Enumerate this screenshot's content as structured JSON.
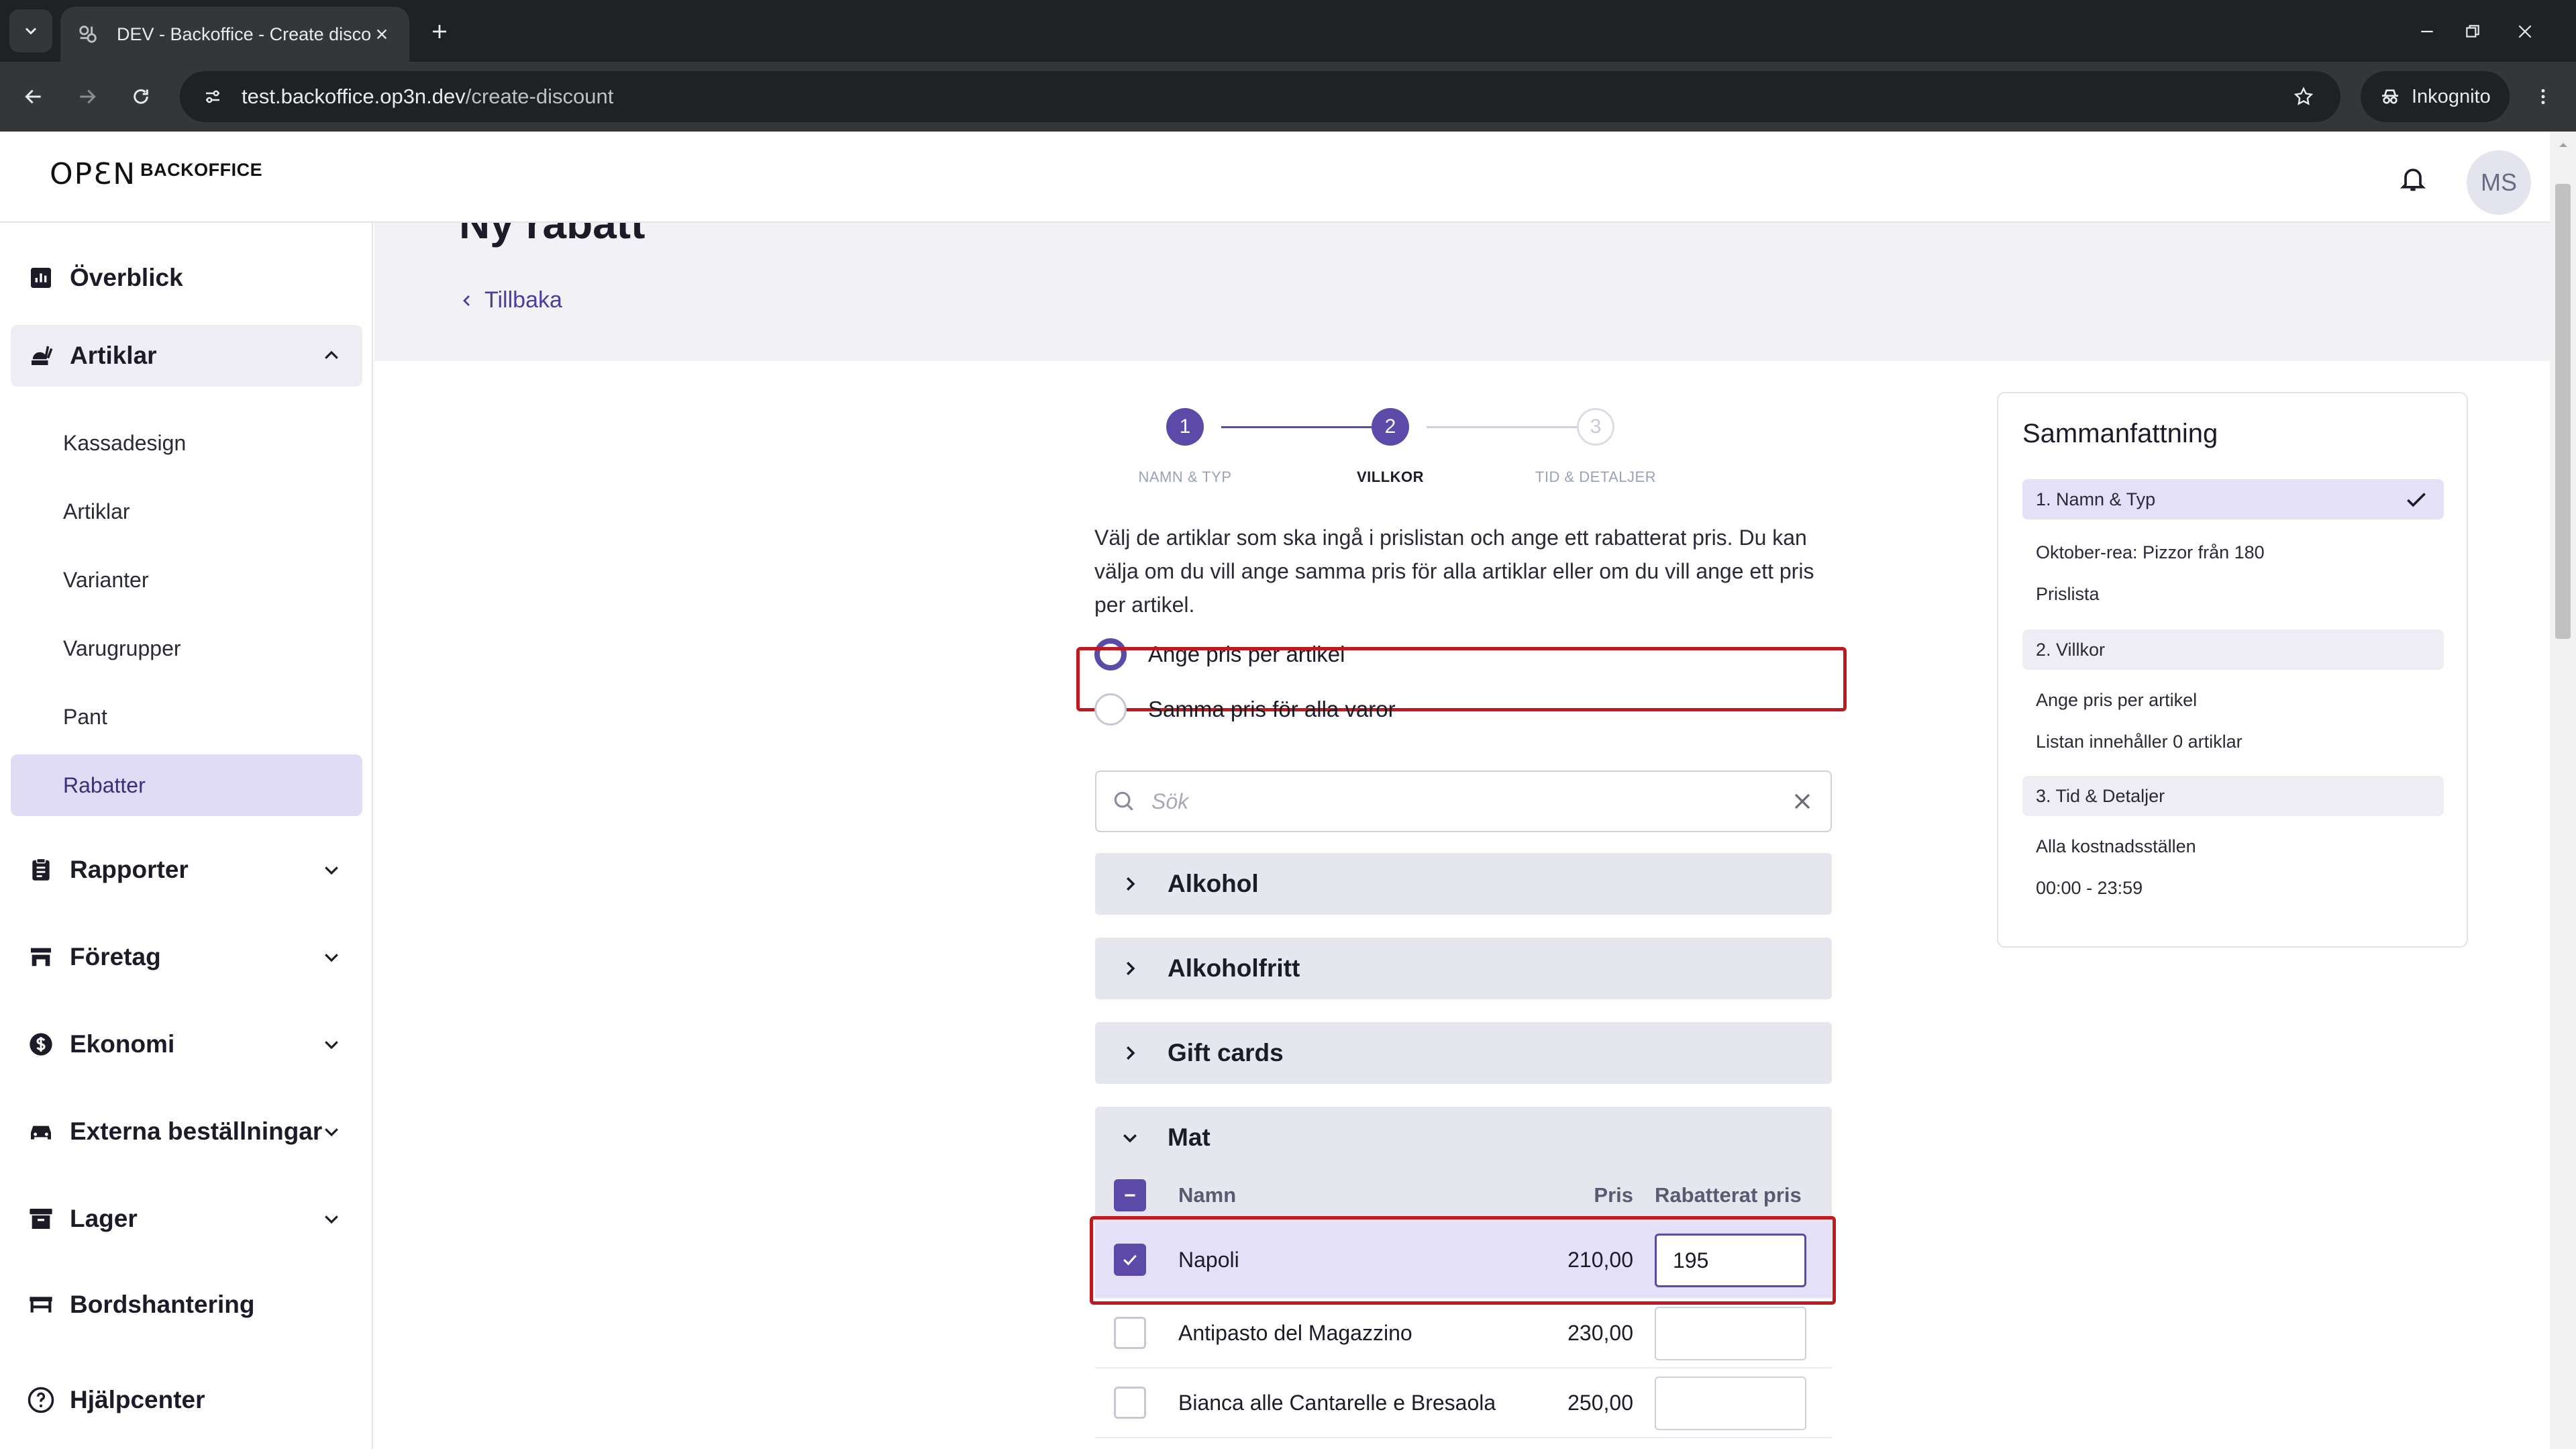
{
  "browser": {
    "tab_title": "DEV - Backoffice - Create disco",
    "url_host": "test.backoffice.op3n.dev",
    "url_path": "/create-discount",
    "incognito_label": "Inkognito"
  },
  "header": {
    "logo_mark": "OPƐN",
    "logo_text": "BACKOFFICE",
    "avatar_initials": "MS"
  },
  "sidebar": {
    "items": [
      {
        "label": "Överblick",
        "icon": "bar-chart-icon"
      },
      {
        "label": "Artiklar",
        "icon": "food-icon",
        "open": true
      },
      {
        "label": "Rapporter",
        "icon": "report-icon"
      },
      {
        "label": "Företag",
        "icon": "store-icon"
      },
      {
        "label": "Ekonomi",
        "icon": "dollar-icon"
      },
      {
        "label": "Externa beställningar",
        "icon": "car-icon"
      },
      {
        "label": "Lager",
        "icon": "archive-icon"
      },
      {
        "label": "Bordshantering",
        "icon": "table-icon"
      },
      {
        "label": "Hjälpcenter",
        "icon": "help-icon"
      }
    ],
    "sub_items": [
      "Kassadesign",
      "Artiklar",
      "Varianter",
      "Varugrupper",
      "Pant",
      "Rabatter"
    ],
    "active_sub": "Rabatter"
  },
  "page": {
    "title": "Ny rabatt",
    "back_label": "Tillbaka"
  },
  "stepper": {
    "steps": [
      {
        "number": "1",
        "label": "NAMN & TYP",
        "state": "done"
      },
      {
        "number": "2",
        "label": "VILLKOR",
        "state": "current"
      },
      {
        "number": "3",
        "label": "TID & DETALJER",
        "state": "todo"
      }
    ]
  },
  "form": {
    "intro": "Välj de artiklar som ska ingå i prislistan och ange ett rabatterat pris. Du kan välja om du vill ange samma pris för alla artiklar eller om du vill ange ett pris per artikel.",
    "radio_options": [
      {
        "label": "Ange pris per artikel",
        "selected": true
      },
      {
        "label": "Samma pris för alla varor",
        "selected": false
      }
    ],
    "search_placeholder": "Sök",
    "groups": [
      {
        "name": "Alkohol",
        "expanded": false
      },
      {
        "name": "Alkoholfritt",
        "expanded": false
      },
      {
        "name": "Gift cards",
        "expanded": false
      },
      {
        "name": "Mat",
        "expanded": true
      }
    ],
    "table": {
      "columns": {
        "name": "Namn",
        "price": "Pris",
        "discount": "Rabatterat pris"
      },
      "rows": [
        {
          "name": "Napoli",
          "price": "210,00",
          "discount": "195",
          "checked": true
        },
        {
          "name": "Antipasto del Magazzino",
          "price": "230,00",
          "discount": "",
          "checked": false
        },
        {
          "name": "Bianca alle Cantarelle e Bresaola",
          "price": "250,00",
          "discount": "",
          "checked": false
        }
      ]
    }
  },
  "summary": {
    "title": "Sammanfattning",
    "sections": [
      {
        "heading": "1. Namn & Typ",
        "done": true,
        "lines": [
          "Oktober-rea: Pizzor från 180",
          "Prislista"
        ]
      },
      {
        "heading": "2. Villkor",
        "done": false,
        "lines": [
          "Ange pris per artikel",
          "Listan innehåller 0 artiklar"
        ]
      },
      {
        "heading": "3. Tid & Detaljer",
        "done": false,
        "lines": [
          "Alla kostnadsställen",
          "00:00 - 23:59"
        ]
      }
    ]
  },
  "colors": {
    "accent": "#5b4aa7",
    "highlight_border": "#c0191f",
    "active_nav_bg": "#e0dcf6"
  }
}
